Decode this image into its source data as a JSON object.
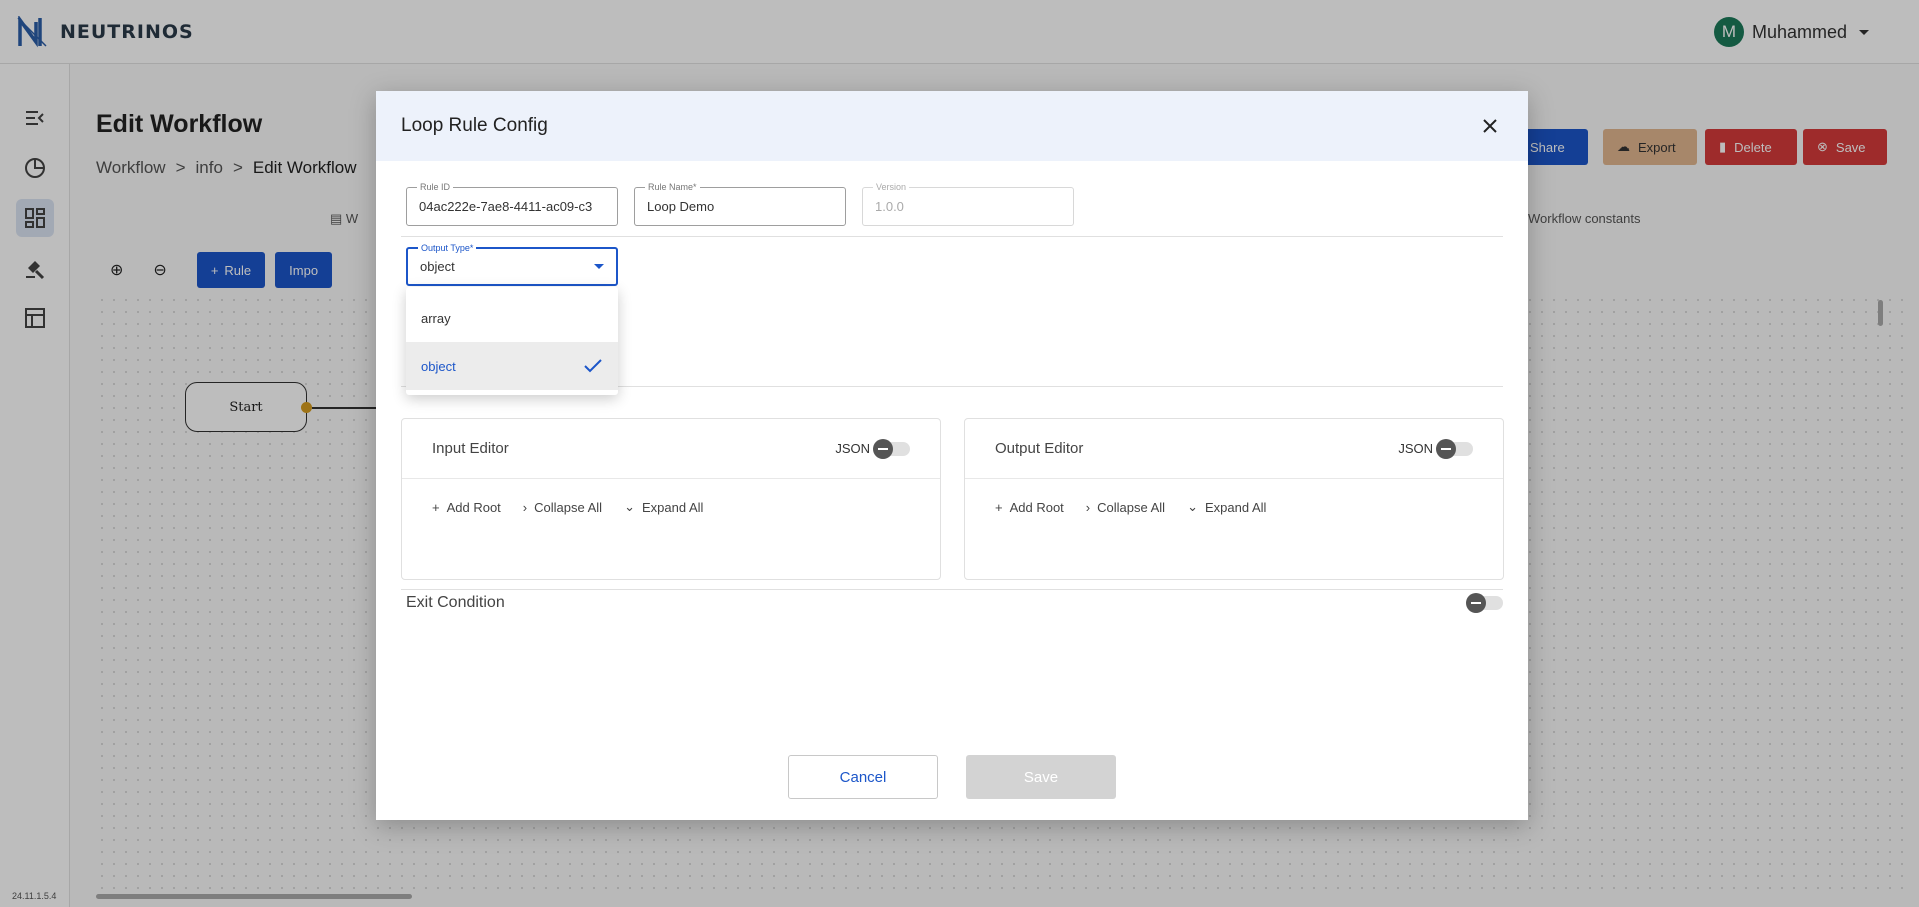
{
  "app": {
    "logo_text": "NEUTRINOS",
    "user_initial": "M",
    "user_name": "Muhammed",
    "version": "24.11.1.5.4"
  },
  "page": {
    "title": "Edit Workflow",
    "breadcrumb": [
      "Workflow",
      ">",
      "info",
      ">",
      "Edit Workflow"
    ],
    "share_label": "Share",
    "export_label": "Export",
    "delete_label": "Delete",
    "save_label": "Save",
    "tab_partial": "W",
    "workflow_constants": "Workflow constants",
    "rule_btn": "Rule",
    "import_btn_partial": "Impo",
    "start_node": "Start"
  },
  "modal": {
    "title": "Loop Rule Config",
    "rule_id": {
      "label": "Rule ID",
      "value": "04ac222e-7ae8-4411-ac09-c3"
    },
    "rule_name": {
      "label": "Rule Name*",
      "value": "Loop Demo"
    },
    "version": {
      "label": "Version",
      "value": "1.0.0"
    },
    "output_type": {
      "label": "Output Type*",
      "value": "object",
      "options": [
        "array",
        "object"
      ],
      "selected": "object"
    },
    "input_editor": {
      "title": "Input Editor",
      "json_label": "JSON",
      "add_root": "Add Root",
      "collapse_all": "Collapse All",
      "expand_all": "Expand All"
    },
    "output_editor": {
      "title": "Output Editor",
      "json_label": "JSON",
      "add_root": "Add Root",
      "collapse_all": "Collapse All",
      "expand_all": "Expand All"
    },
    "exit_condition": "Exit Condition",
    "cancel_label": "Cancel",
    "save_label": "Save"
  },
  "colors": {
    "primary": "#1c56c9",
    "danger": "#d63a3a",
    "export": "#e2b68f",
    "header_bg": "#edf2fb",
    "node_dot": "#d59b1e"
  }
}
